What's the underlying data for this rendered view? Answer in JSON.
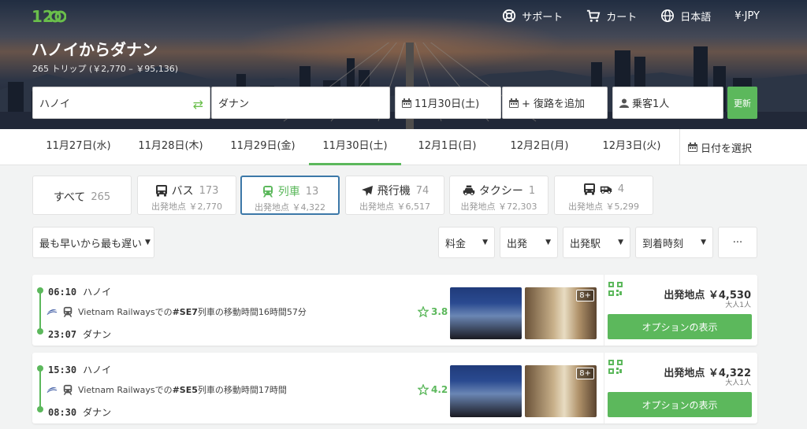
{
  "nav": {
    "logo_text": "12go",
    "support": "サポート",
    "cart": "カート",
    "language": "日本語",
    "currency": "¥·JPY"
  },
  "route": {
    "title": "ハノイからダナン",
    "subtitle": "265 トリップ (￥2,770 – ￥95,136)"
  },
  "search": {
    "from": "ハノイ",
    "to": "ダナン",
    "date": "11月30日(土)",
    "return": "+ 復路を追加",
    "passengers": "乗客1人",
    "refresh": "更新"
  },
  "dates": {
    "items": [
      "11月27日(水)",
      "11月28日(木)",
      "11月29日(金)",
      "11月30日(土)",
      "12月1日(日)",
      "12月2日(月)",
      "12月3日(火)"
    ],
    "active_index": 3,
    "pick_label": "日付を選択"
  },
  "modes": [
    {
      "label": "すべて",
      "count": "265",
      "price": ""
    },
    {
      "label": "バス",
      "count": "173",
      "price": "出発地点 ￥2,770"
    },
    {
      "label": "列車",
      "count": "13",
      "price": "出発地点 ￥4,322"
    },
    {
      "label": "飛行機",
      "count": "74",
      "price": "出発地点 ￥6,517"
    },
    {
      "label": "タクシー",
      "count": "1",
      "price": "出発地点 ￥72,303"
    },
    {
      "label": "",
      "count": "4",
      "price": "出発地点 ￥5,299"
    }
  ],
  "filters": {
    "sort": "最も早いから最も遅い",
    "price": "料金",
    "departure": "出発",
    "station": "出発駅",
    "arrival": "到着時刻",
    "more": "···"
  },
  "results": [
    {
      "dep_time": "06:10",
      "dep_place": "ハノイ",
      "operator_text": "Vietnam Railwaysでの",
      "train_no": "#SE7",
      "duration_text": "列車の移動時間16時間57分",
      "arr_time": "23:07",
      "arr_place": "ダナン",
      "rating": "3.8",
      "photo_badge": "8+",
      "price": "出発地点 ￥4,530",
      "pax": "大人1人",
      "button": "オプションの表示"
    },
    {
      "dep_time": "15:30",
      "dep_place": "ハノイ",
      "operator_text": "Vietnam Railwaysでの",
      "train_no": "#SE5",
      "duration_text": "列車の移動時間17時間",
      "arr_time": "08:30",
      "arr_place": "ダナン",
      "rating": "4.2",
      "photo_badge": "8+",
      "price": "出発地点 ￥4,322",
      "pax": "大人1人",
      "button": "オプションの表示"
    }
  ],
  "colors": {
    "accent": "#5cb85c",
    "active_border": "#3c78a8"
  }
}
